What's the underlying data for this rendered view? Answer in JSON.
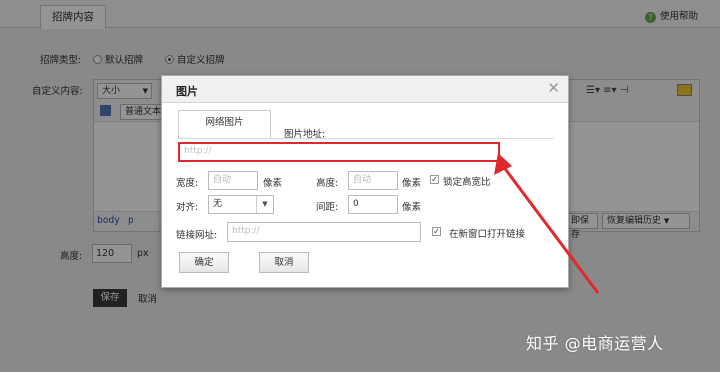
{
  "tabs": {
    "active": "招牌内容"
  },
  "help": {
    "label": "使用帮助"
  },
  "form": {
    "sign_type_label": "招牌类型:",
    "option_default": "默认招牌",
    "option_custom": "自定义招牌",
    "custom_content_label": "自定义内容:",
    "height_label": "高度:",
    "height_value": "120",
    "height_unit": "px",
    "save": "保存",
    "cancel": "取消"
  },
  "editor": {
    "size_select": "大小",
    "text_select": "普通文本",
    "path_body": "body",
    "path_p": "p",
    "local_save": "即保存",
    "restore_history": "恢复编辑历史"
  },
  "dialog": {
    "title": "图片",
    "tab": "网络图片",
    "url_label": "图片地址:",
    "url_placeholder": "http://",
    "width_label": "宽度:",
    "width_placeholder": "自动",
    "height_label": "高度:",
    "height_placeholder": "自动",
    "unit": "像素",
    "lock_ratio": "锁定高宽比",
    "align_label": "对齐:",
    "align_value": "无",
    "spacing_label": "间距:",
    "spacing_value": "0",
    "link_label": "链接网址:",
    "link_placeholder": "http://",
    "new_window": "在新窗口打开链接",
    "ok": "确定",
    "cancel": "取消"
  },
  "watermark": "知乎 @电商运营人",
  "colors": {
    "highlight": "#e0282d",
    "arrow": "#e0282d"
  }
}
